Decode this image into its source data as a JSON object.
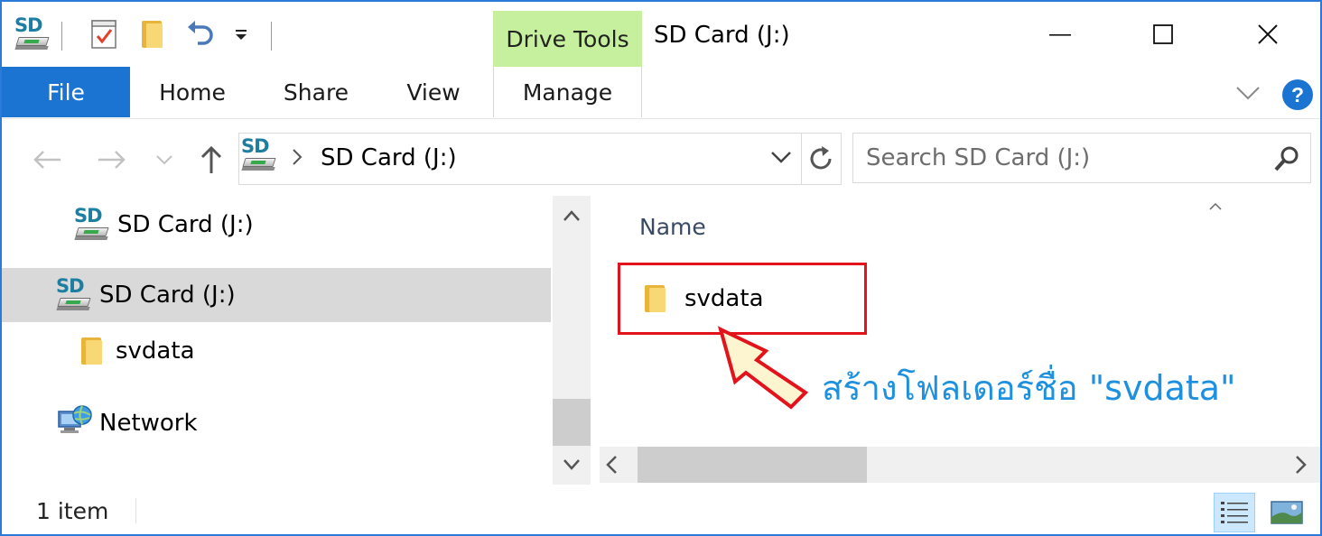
{
  "window": {
    "title": "SD Card (J:)",
    "contextual_tab_group": "Drive Tools"
  },
  "ribbon": {
    "tabs": [
      {
        "label": "File"
      },
      {
        "label": "Home"
      },
      {
        "label": "Share"
      },
      {
        "label": "View"
      },
      {
        "label": "Manage"
      }
    ]
  },
  "address_bar": {
    "path": "SD Card (J:)",
    "search_placeholder": "Search SD Card (J:)"
  },
  "navigation_pane": {
    "items": [
      {
        "label": "SD Card (J:)",
        "icon": "sd-card-icon"
      },
      {
        "label": "SD Card (J:)",
        "icon": "sd-card-icon",
        "selected": true
      },
      {
        "label": "svdata",
        "icon": "folder-icon"
      },
      {
        "label": "Network",
        "icon": "network-icon"
      }
    ]
  },
  "content": {
    "column_header": "Name",
    "files": [
      {
        "name": "svdata",
        "type": "folder"
      }
    ],
    "annotation": "สร้างโฟลเดอร์ชื่อ \"svdata\""
  },
  "status_bar": {
    "item_count": "1 item"
  },
  "colors": {
    "accent": "#1b74d1",
    "drive_tools": "#c6ef9e",
    "highlight": "#e3131b",
    "annotation_text": "#1e90e0"
  }
}
